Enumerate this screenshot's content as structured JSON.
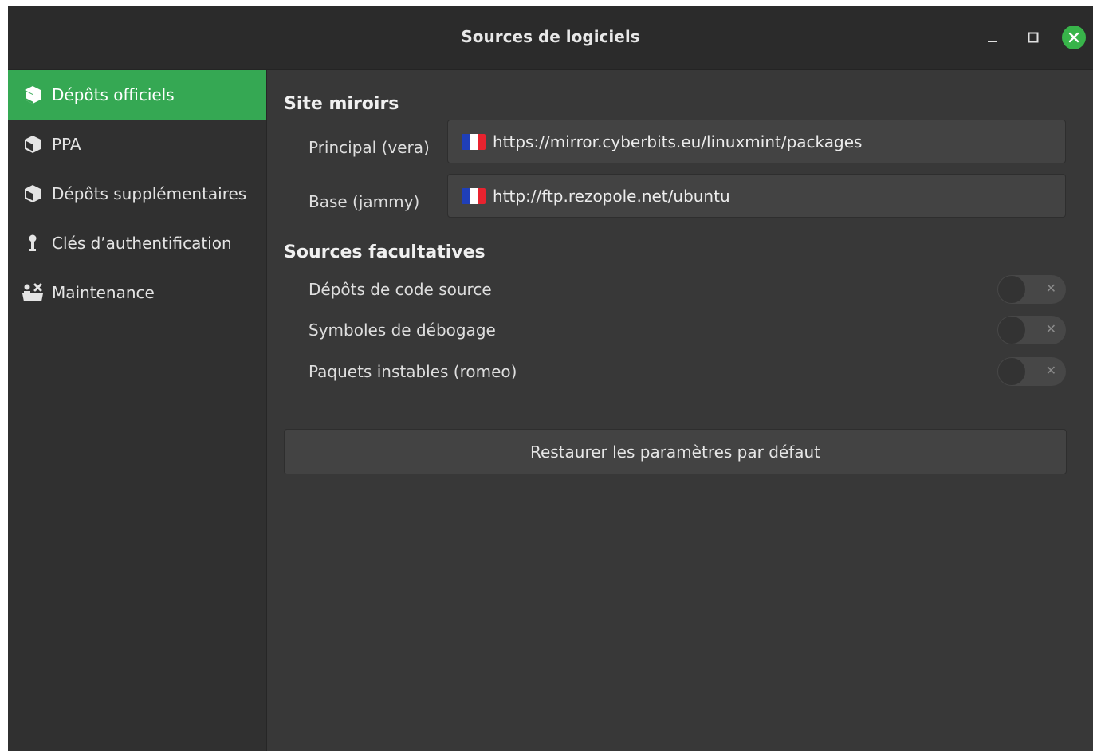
{
  "window": {
    "title": "Sources de logiciels",
    "controls": {
      "minimize": "minimize-icon",
      "maximize": "maximize-icon",
      "close": "close-icon"
    }
  },
  "sidebar": {
    "items": [
      {
        "label": "Dépôts officiels",
        "icon": "package-icon",
        "active": true
      },
      {
        "label": "PPA",
        "icon": "package-icon",
        "active": false
      },
      {
        "label": "Dépôts supplémentaires",
        "icon": "package-icon",
        "active": false
      },
      {
        "label": "Clés d’authentification",
        "icon": "key-icon",
        "active": false
      },
      {
        "label": "Maintenance",
        "icon": "maintenance-icon",
        "active": false
      }
    ]
  },
  "mirrors": {
    "heading": "Site miroirs",
    "rows": [
      {
        "label": "Principal (vera)",
        "url": "https://mirror.cyberbits.eu/linuxmint/packages",
        "flag": "france-flag-icon"
      },
      {
        "label": "Base (jammy)",
        "url": "http://ftp.rezopole.net/ubuntu",
        "flag": "france-flag-icon"
      }
    ]
  },
  "optional": {
    "heading": "Sources facultatives",
    "toggles": [
      {
        "label": "Dépôts de code source",
        "enabled": false
      },
      {
        "label": "Symboles de débogage",
        "enabled": false
      },
      {
        "label": "Paquets instables (romeo)",
        "enabled": false
      }
    ]
  },
  "restore_button": {
    "label": "Restaurer les paramètres par défaut"
  },
  "colors": {
    "accent": "#35a853",
    "close_button": "#38b44a",
    "background": "#383838",
    "sidebar": "#303030",
    "titlebar": "#2b2b2b"
  }
}
